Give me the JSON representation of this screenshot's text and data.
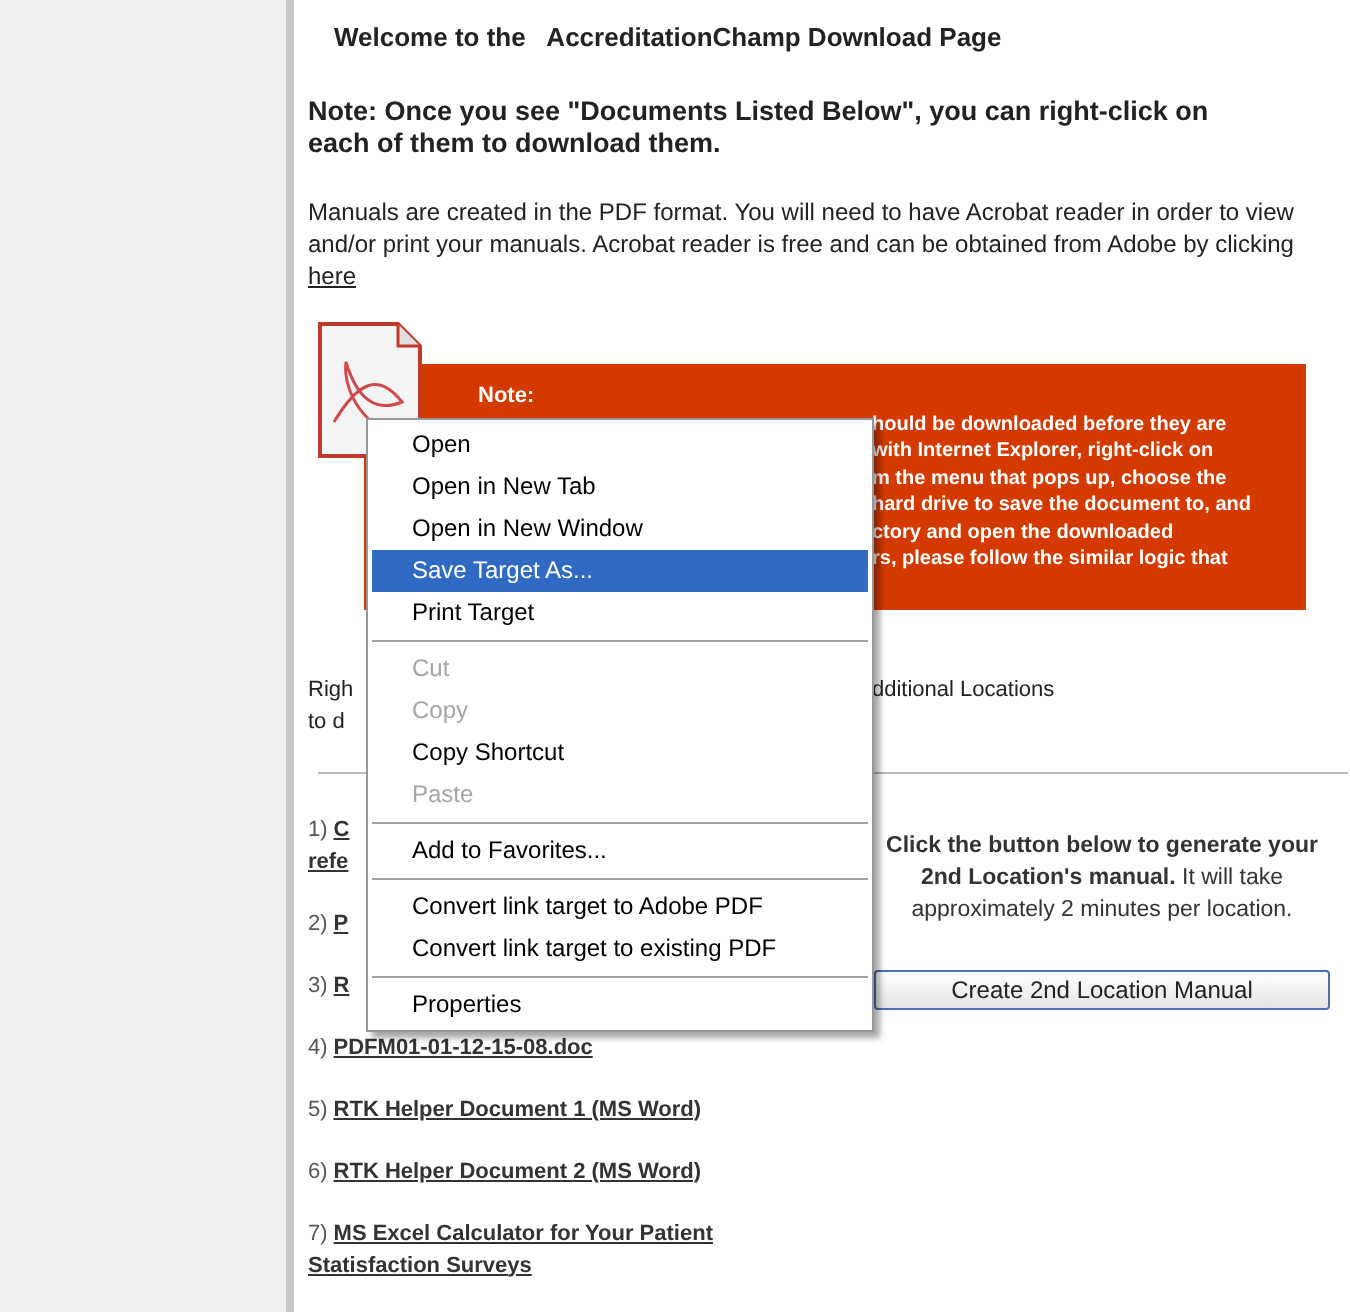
{
  "page": {
    "heading": "Welcome to the   AccreditationChamp Download Page",
    "note": "Note: Once you see \"Documents Listed Below\", you can right-click on each of them to download them.",
    "intro": "Manuals are created in the PDF format. You will need to have Acrobat reader in order to view and/or print your manuals. Acrobat reader is free and can be obtained from Adobe by clicking",
    "intro_link": "here"
  },
  "notice": {
    "title": "Note:",
    "lines": [
      "hould be downloaded before they are",
      "with Internet Explorer, right-click on",
      "m the menu that pops up, choose the",
      "hard drive to save the document to, and",
      "ctory and open the downloaded",
      "rs, please follow the similar logic that"
    ]
  },
  "instructions": [
    {
      "left": "Righ",
      "right": "dditional Locations"
    },
    {
      "left": "to d"
    }
  ],
  "documents": [
    {
      "number": "1)",
      "lines": [
        "C",
        "refe"
      ]
    },
    {
      "number": "2)",
      "lines": [
        "P"
      ]
    },
    {
      "number": "3)",
      "lines": [
        "R"
      ]
    },
    {
      "number": "4)",
      "lines": [
        "PDFM01-01-12-15-08.doc"
      ]
    },
    {
      "number": "5)",
      "lines": [
        "RTK Helper Document 1 (MS Word)"
      ]
    },
    {
      "number": "6)",
      "lines": [
        "RTK Helper Document 2 (MS Word)"
      ]
    },
    {
      "number": "7)",
      "lines": [
        "MS Excel Calculator for Your Patient",
        "Statisfaction Surveys"
      ]
    }
  ],
  "generate_panel": {
    "text": "**Click the button below to generate your 2nd Location's manual.** It will take approximately 2 minutes per location.",
    "button": "Create 2nd Location Manual"
  },
  "context_menu": {
    "items": [
      {
        "kind": "item",
        "label": "Open",
        "selected": false,
        "disabled": false
      },
      {
        "kind": "item",
        "label": "Open in New Tab",
        "selected": false,
        "disabled": false
      },
      {
        "kind": "item",
        "label": "Open in New Window",
        "selected": false,
        "disabled": false
      },
      {
        "kind": "item",
        "label": "Save Target As...",
        "selected": true,
        "disabled": false
      },
      {
        "kind": "item",
        "label": "Print Target",
        "selected": false,
        "disabled": false
      },
      {
        "kind": "separator"
      },
      {
        "kind": "item",
        "label": "Cut",
        "selected": false,
        "disabled": true
      },
      {
        "kind": "item",
        "label": "Copy",
        "selected": false,
        "disabled": true
      },
      {
        "kind": "item",
        "label": "Copy Shortcut",
        "selected": false,
        "disabled": false
      },
      {
        "kind": "item",
        "label": "Paste",
        "selected": false,
        "disabled": true
      },
      {
        "kind": "separator"
      },
      {
        "kind": "item",
        "label": "Add to Favorites...",
        "selected": false,
        "disabled": false
      },
      {
        "kind": "separator"
      },
      {
        "kind": "item",
        "label": "Convert link target to Adobe PDF",
        "selected": false,
        "disabled": false
      },
      {
        "kind": "item",
        "label": "Convert link target to existing PDF",
        "selected": false,
        "disabled": false
      },
      {
        "kind": "separator"
      },
      {
        "kind": "item",
        "label": "Properties",
        "selected": false,
        "disabled": false
      }
    ]
  }
}
